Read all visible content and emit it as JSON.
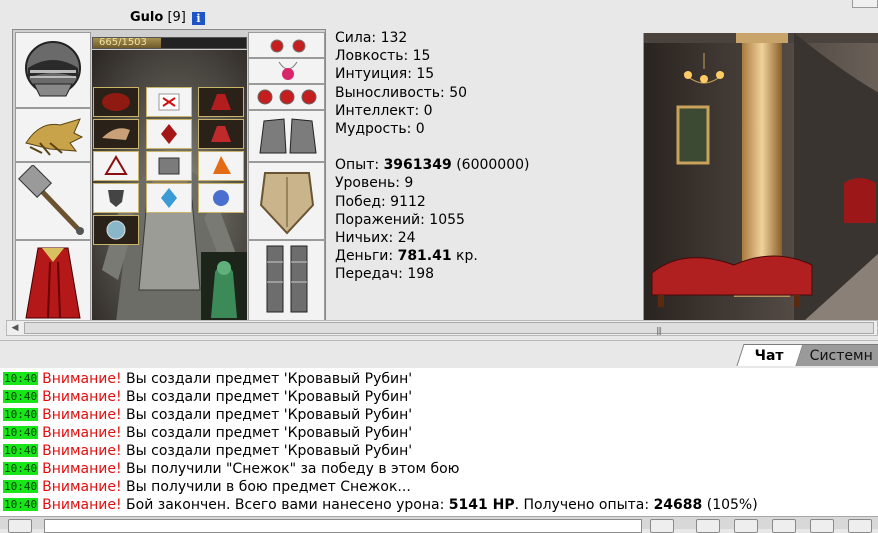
{
  "character": {
    "name": "Gulo",
    "level": "[9]",
    "info_icon": "info-icon",
    "hp_text": "665/1503",
    "hp_fraction": 0.442
  },
  "stats": {
    "strength": "Сила: 132",
    "agility": "Ловкость: 15",
    "intuition": "Интуиция: 15",
    "endurance": "Выносливость: 50",
    "intellect": "Интеллект: 0",
    "wisdom": "Мудрость: 0",
    "exp_label": "Опыт: ",
    "exp_value": "3961349",
    "exp_next": " (6000000)",
    "level": "Уровень: 9",
    "wins": "Побед: 9112",
    "losses": "Поражений: 1055",
    "draws": "Ничьих: 24",
    "money_label": "Деньги: ",
    "money_value": "781.41",
    "money_unit": " кр.",
    "transfers": "Передач: 198"
  },
  "tabs": {
    "chat": "Чат",
    "system": "Системн"
  },
  "chat": {
    "messages": [
      {
        "time": "10:40",
        "warn": "Внимание!",
        "text": " Вы создали предмет 'Кровавый Рубин'"
      },
      {
        "time": "10:40",
        "warn": "Внимание!",
        "text": " Вы создали предмет 'Кровавый Рубин'"
      },
      {
        "time": "10:40",
        "warn": "Внимание!",
        "text": " Вы создали предмет 'Кровавый Рубин'"
      },
      {
        "time": "10:40",
        "warn": "Внимание!",
        "text": " Вы создали предмет 'Кровавый Рубин'"
      },
      {
        "time": "10:40",
        "warn": "Внимание!",
        "text": " Вы создали предмет 'Кровавый Рубин'"
      },
      {
        "time": "10:40",
        "warn": "Внимание!",
        "text": " Вы получили \"Снежок\" за победу в этом бою"
      },
      {
        "time": "10:40",
        "warn": "Внимание!",
        "text": " Вы получили в бою предмет Снежок..."
      },
      {
        "time": "10:40",
        "warn": "Внимание!",
        "text_a": " Бой закончен. Всего вами нанесено урона: ",
        "bold_a": "5141 HP",
        "text_b": ". Получено опыта: ",
        "bold_b": "24688",
        "text_c": " (105%)"
      }
    ]
  },
  "colors": {
    "warning": "#e01010",
    "timestamp_bg": "#19e619"
  }
}
